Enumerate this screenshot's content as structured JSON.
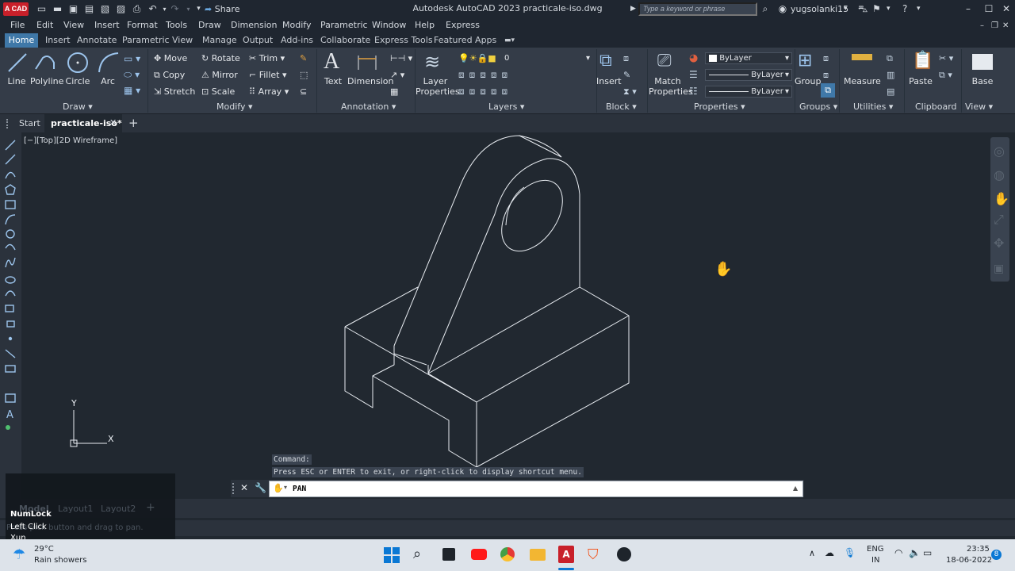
{
  "titlebar": {
    "app_logo": "A CAD",
    "share_label": "Share",
    "window_title": "Autodesk AutoCAD 2023    practicale-iso.dwg",
    "search_placeholder": "Type a keyword or phrase",
    "username": "yugsolanki15"
  },
  "menubar": [
    "File",
    "Edit",
    "View",
    "Insert",
    "Format",
    "Tools",
    "Draw",
    "Dimension",
    "Modify",
    "Parametric",
    "Window",
    "Help",
    "Express"
  ],
  "ribbon_tabs": [
    "Home",
    "Insert",
    "Annotate",
    "Parametric",
    "View",
    "Manage",
    "Output",
    "Add-ins",
    "Collaborate",
    "Express Tools",
    "Featured Apps"
  ],
  "ribbon": {
    "draw": {
      "line": "Line",
      "polyline": "Polyline",
      "circle": "Circle",
      "arc": "Arc",
      "title": "Draw"
    },
    "modify": {
      "move": "Move",
      "rotate": "Rotate",
      "trim": "Trim",
      "copy": "Copy",
      "mirror": "Mirror",
      "fillet": "Fillet",
      "stretch": "Stretch",
      "scale": "Scale",
      "array": "Array",
      "title": "Modify"
    },
    "annotation": {
      "text": "Text",
      "dimension": "Dimension",
      "title": "Annotation"
    },
    "layers": {
      "layer_properties_1": "Layer",
      "layer_properties_2": "Properties",
      "current_layer": "0",
      "title": "Layers"
    },
    "block": {
      "insert": "Insert",
      "title": "Block"
    },
    "properties": {
      "match_1": "Match",
      "match_2": "Properties",
      "color": "ByLayer",
      "linetype": "ByLayer",
      "lineweight": "ByLayer",
      "title": "Properties"
    },
    "groups": {
      "group": "Group",
      "title": "Groups"
    },
    "utilities": {
      "measure": "Measure",
      "title": "Utilities"
    },
    "clipboard": {
      "paste": "Paste",
      "title": "Clipboard"
    },
    "view": {
      "base": "Base",
      "title": "View"
    }
  },
  "doc_tabs": {
    "start": "Start",
    "active": "practicale-iso*"
  },
  "viewport_label": "[−][Top][2D Wireframe]",
  "ucs": {
    "x": "X",
    "y": "Y"
  },
  "command": {
    "history_1": "Command:",
    "history_2": "Press ESC or ENTER to exit, or right-click to display shortcut menu.",
    "current": "PAN"
  },
  "layout_tabs": [
    "Model",
    "Layout1",
    "Layout2"
  ],
  "status_hint": "Press pick button and drag to pan.",
  "tooltip": {
    "line1": "NumLock",
    "line2": "Left Click",
    "line3": "Xun"
  },
  "taskbar": {
    "weather_temp": "29°C",
    "weather_desc": "Rain showers",
    "lang_1": "ENG",
    "lang_2": "IN",
    "time": "23:35",
    "date": "18-06-2022",
    "badge": "8"
  },
  "colors": {
    "accent": "#3f78a8",
    "canvas_bg": "#212830",
    "ribbon_bg": "#343c48",
    "logo_red": "#c8202a"
  }
}
